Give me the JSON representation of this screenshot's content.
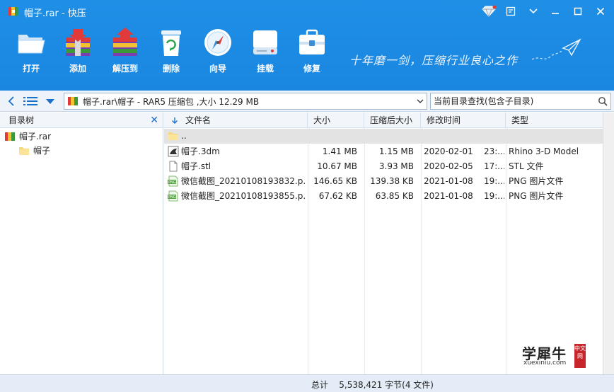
{
  "window": {
    "title": "帽子.rar - 快压"
  },
  "toolbar": {
    "items": [
      {
        "label": "打开",
        "icon": "open-folder-icon"
      },
      {
        "label": "添加",
        "icon": "add-archive-icon"
      },
      {
        "label": "解压到",
        "icon": "extract-icon"
      },
      {
        "label": "删除",
        "icon": "recycle-bin-icon"
      },
      {
        "label": "向导",
        "icon": "compass-icon"
      },
      {
        "label": "挂载",
        "icon": "drive-icon"
      },
      {
        "label": "修复",
        "icon": "toolbox-icon"
      }
    ],
    "slogan": "十年磨一剑，压缩行业良心之作"
  },
  "address": {
    "path": "帽子.rar\\帽子 - RAR5 压缩包 ,大小 12.29 MB",
    "search_placeholder": "当前目录查找(包含子目录)"
  },
  "tree": {
    "title": "目录树",
    "root": "帽子.rar",
    "child": "帽子"
  },
  "columns": {
    "name": "文件名",
    "size": "大小",
    "packed": "压缩后大小",
    "modified": "修改时间",
    "type": "类型"
  },
  "files": [
    {
      "name": "..",
      "size": "",
      "packed": "",
      "modified": "",
      "type": "",
      "icon": "folder-icon"
    },
    {
      "name": "帽子.3dm",
      "size": "1.41 MB",
      "packed": "1.15 MB",
      "modified": "2020-02-01    23:...",
      "type": "Rhino 3-D Model",
      "icon": "rhino-file-icon"
    },
    {
      "name": "帽子.stl",
      "size": "10.67 MB",
      "packed": "3.93 MB",
      "modified": "2020-02-05    17:...",
      "type": "STL 文件",
      "icon": "document-icon"
    },
    {
      "name": "微信截图_20210108193832.p...",
      "size": "146.65 KB",
      "packed": "139.38 KB",
      "modified": "2021-01-08    19:...",
      "type": "PNG 图片文件",
      "icon": "png-file-icon"
    },
    {
      "name": "微信截图_20210108193855.p...",
      "size": "67.62 KB",
      "packed": "63.85 KB",
      "modified": "2021-01-08    19:...",
      "type": "PNG 图片文件",
      "icon": "png-file-icon"
    }
  ],
  "status": {
    "summary": "总计    5,538,421 字节(4 文件)"
  },
  "watermark": {
    "main": "学犀牛",
    "url": "xuexiniu.com",
    "seal": "中文网"
  },
  "colors": {
    "toolbar_blue": "#1a86e0",
    "header_bg": "#f2f6fb",
    "status_bg": "#e4edf7",
    "updir_row": "#e3e3e3"
  }
}
